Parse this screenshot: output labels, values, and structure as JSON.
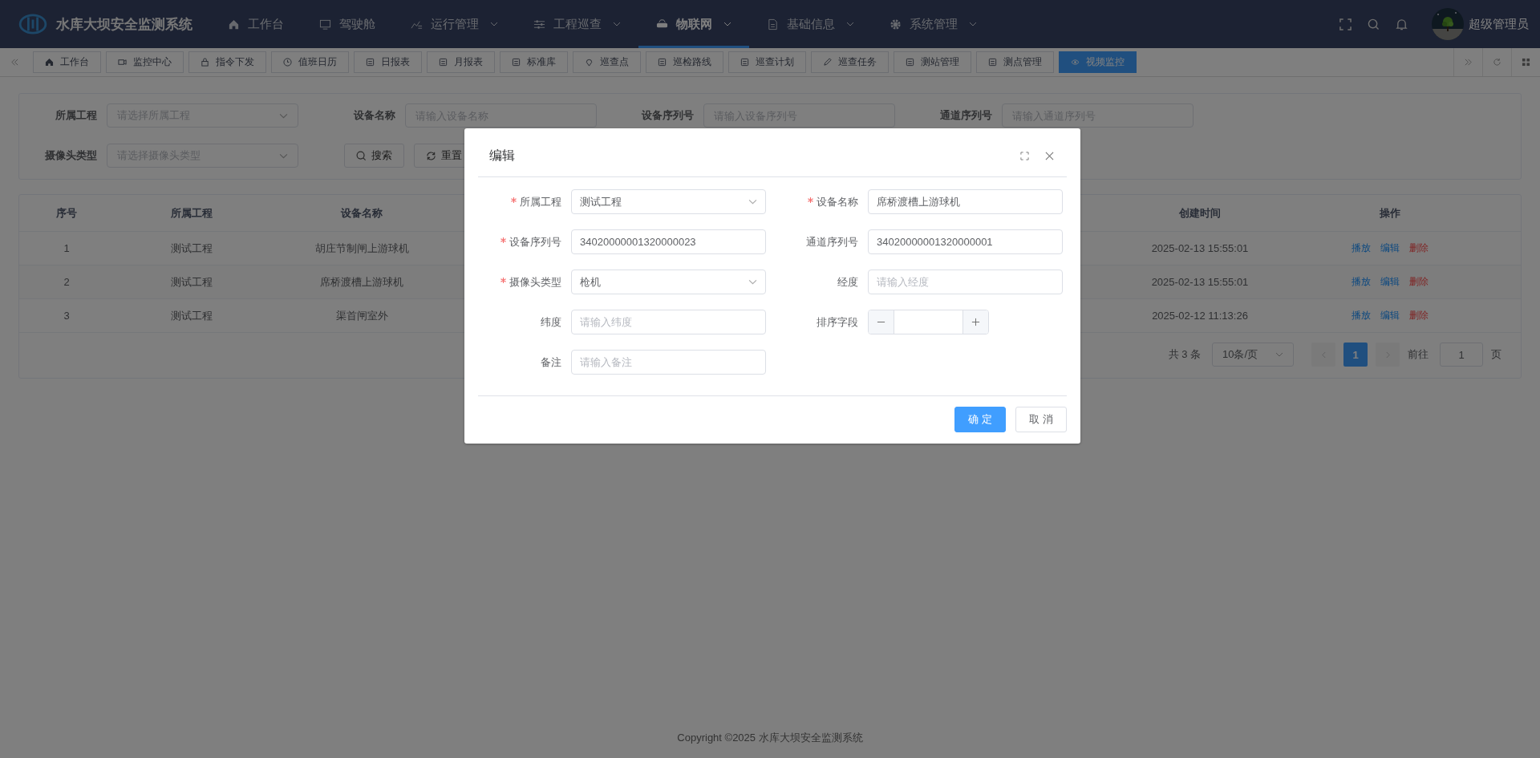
{
  "header": {
    "title": "水库大坝安全监测系统",
    "menu": [
      {
        "label": "工作台",
        "selected": false,
        "has_dropdown": false
      },
      {
        "label": "驾驶舱",
        "selected": false,
        "has_dropdown": false
      },
      {
        "label": "运行管理",
        "selected": false,
        "has_dropdown": true
      },
      {
        "label": "工程巡查",
        "selected": false,
        "has_dropdown": true
      },
      {
        "label": "物联网",
        "selected": true,
        "has_dropdown": true
      },
      {
        "label": "基础信息",
        "selected": false,
        "has_dropdown": true
      },
      {
        "label": "系统管理",
        "selected": false,
        "has_dropdown": true
      }
    ],
    "user": {
      "name": "超级管理员"
    }
  },
  "tabs": [
    {
      "label": "工作台",
      "selected": false
    },
    {
      "label": "监控中心",
      "selected": false
    },
    {
      "label": "指令下发",
      "selected": false
    },
    {
      "label": "值班日历",
      "selected": false
    },
    {
      "label": "日报表",
      "selected": false
    },
    {
      "label": "月报表",
      "selected": false
    },
    {
      "label": "标准库",
      "selected": false
    },
    {
      "label": "巡查点",
      "selected": false
    },
    {
      "label": "巡检路线",
      "selected": false
    },
    {
      "label": "巡查计划",
      "selected": false
    },
    {
      "label": "巡查任务",
      "selected": false
    },
    {
      "label": "测站管理",
      "selected": false
    },
    {
      "label": "测点管理",
      "selected": false
    },
    {
      "label": "视频监控",
      "selected": true
    }
  ],
  "filters": [
    {
      "label": "所属工程",
      "kind": "select",
      "placeholder": "请选择所属工程"
    },
    {
      "label": "设备名称",
      "kind": "input",
      "placeholder": "请输入设备名称"
    },
    {
      "label": "设备序列号",
      "kind": "input",
      "placeholder": "请输入设备序列号"
    },
    {
      "label": "通道序列号",
      "kind": "input",
      "placeholder": "请输入通道序列号"
    },
    {
      "label": "摄像头类型",
      "kind": "select",
      "placeholder": "请选择摄像头类型"
    }
  ],
  "filter_buttons": [
    {
      "label": "搜索",
      "kind": "search"
    },
    {
      "label": "重置",
      "kind": "reset"
    }
  ],
  "table": {
    "columns": [
      "序号",
      "所属工程",
      "设备名称",
      "创建时间",
      "操作"
    ],
    "rows": [
      {
        "cells": [
          "1",
          "测试工程",
          "胡庄节制闸上游球机",
          "2025-02-13 15:55:01"
        ],
        "actions": [
          {
            "label": "播放",
            "kind": "primary"
          },
          {
            "label": "编辑",
            "kind": "primary"
          },
          {
            "label": "删除",
            "kind": "danger"
          }
        ]
      },
      {
        "cells": [
          "2",
          "测试工程",
          "席桥渡槽上游球机",
          "2025-02-13 15:55:01"
        ],
        "actions": [
          {
            "label": "播放",
            "kind": "primary"
          },
          {
            "label": "编辑",
            "kind": "primary"
          },
          {
            "label": "删除",
            "kind": "danger"
          }
        ]
      },
      {
        "cells": [
          "3",
          "测试工程",
          "渠首闸室外",
          "2025-02-12 11:13:26"
        ],
        "actions": [
          {
            "label": "播放",
            "kind": "primary"
          },
          {
            "label": "编辑",
            "kind": "primary"
          },
          {
            "label": "删除",
            "kind": "danger"
          }
        ]
      }
    ]
  },
  "pagination": {
    "total": "共 3 条",
    "page_size": "10条/页",
    "pages": [
      {
        "label": "1",
        "selected": true
      }
    ],
    "goto_label": "前往",
    "goto_value": "1",
    "goto_suffix": "页"
  },
  "dialog": {
    "title": "编辑",
    "fields": [
      {
        "label": "所属工程",
        "required": true,
        "kind": "select",
        "value": "测试工程"
      },
      {
        "label": "设备名称",
        "required": true,
        "kind": "input",
        "value": "席桥渡槽上游球机"
      },
      {
        "label": "设备序列号",
        "required": true,
        "kind": "input",
        "value": "34020000001320000023"
      },
      {
        "label": "通道序列号",
        "required": false,
        "kind": "input",
        "value": "34020000001320000001"
      },
      {
        "label": "摄像头类型",
        "required": true,
        "kind": "select",
        "value": "枪机"
      },
      {
        "label": "经度",
        "required": false,
        "kind": "input",
        "placeholder": "请输入经度"
      },
      {
        "label": "纬度",
        "required": false,
        "kind": "input",
        "placeholder": "请输入纬度"
      },
      {
        "label": "排序字段",
        "required": false,
        "kind": "number"
      },
      {
        "label": "备注",
        "required": false,
        "kind": "input",
        "placeholder": "请输入备注"
      }
    ],
    "buttons": [
      {
        "label": "确 定",
        "kind": "primary"
      },
      {
        "label": "取 消",
        "kind": "default"
      }
    ]
  },
  "footer": "Copyright ©2025 水库大坝安全监测系统"
}
